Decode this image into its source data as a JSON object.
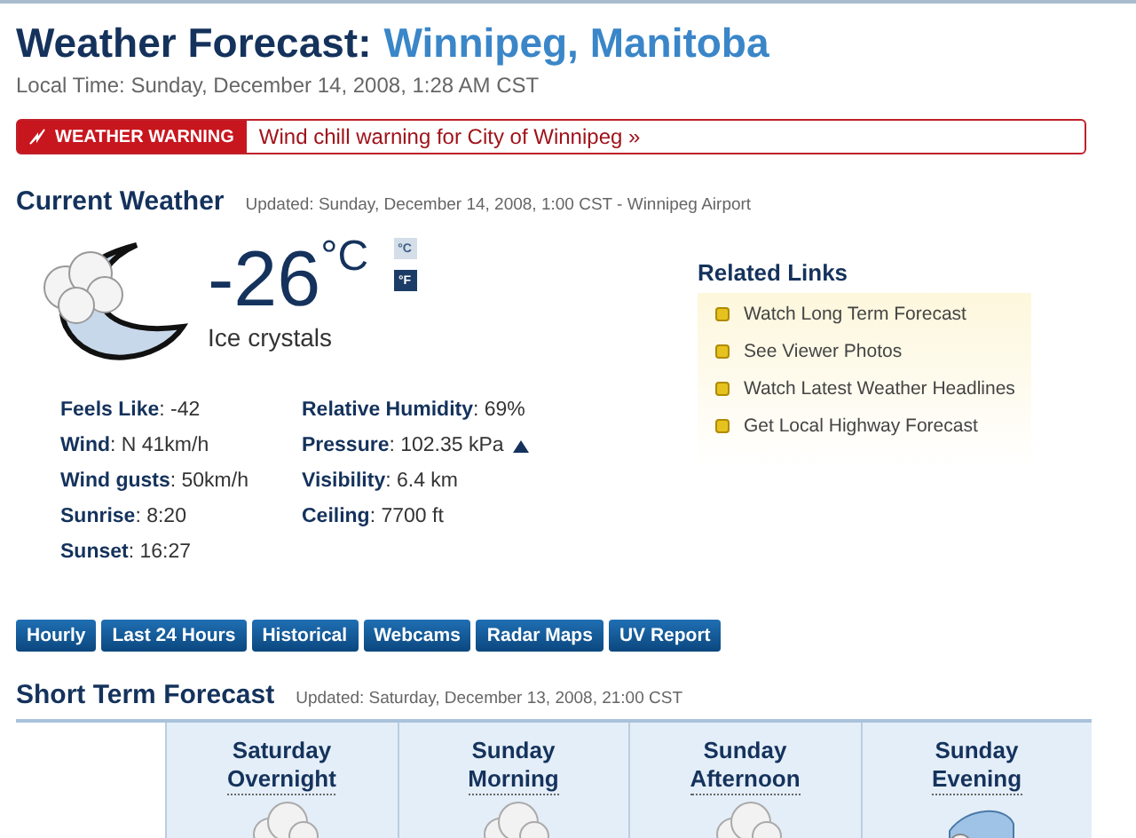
{
  "header": {
    "title": "Weather Forecast:",
    "location": "Winnipeg, Manitoba",
    "local_time": "Local Time: Sunday, December 14, 2008, 1:28 AM CST"
  },
  "warning": {
    "label": "WEATHER WARNING",
    "message": "Wind chill warning for City of Winnipeg »"
  },
  "current": {
    "heading": "Current Weather",
    "updated": "Updated: Sunday, December 14, 2008, 1:00 CST - Winnipeg Airport",
    "temperature": "-26",
    "unit": "°C",
    "condition": "Ice crystals",
    "units": [
      {
        "label": "°C",
        "selected": true
      },
      {
        "label": "°F",
        "selected": false
      }
    ],
    "stats_left": [
      {
        "label": "Feels Like",
        "value": ": -42"
      },
      {
        "label": "Wind",
        "value": ": N 41km/h"
      },
      {
        "label": "Wind gusts",
        "value": ": 50km/h"
      },
      {
        "label": "Sunrise",
        "value": ": 8:20"
      },
      {
        "label": "Sunset",
        "value": ": 16:27"
      }
    ],
    "stats_right": [
      {
        "label": "Relative Humidity",
        "value": ": 69%",
        "kind": "plain"
      },
      {
        "label": "Pressure",
        "value": ": 102.35 kPa",
        "kind": "rising"
      },
      {
        "label": "Visibility",
        "value": ": 6.4 km",
        "kind": "plain"
      },
      {
        "label": "Ceiling",
        "value": ": 7700 ft",
        "kind": "plain"
      }
    ]
  },
  "related_links": {
    "heading": "Related Links",
    "items": [
      "Watch Long Term Forecast",
      "See Viewer Photos",
      "Watch Latest Weather Headlines",
      "Get Local Highway Forecast"
    ]
  },
  "tabs": [
    "Hourly",
    "Last 24 Hours",
    "Historical",
    "Webcams",
    "Radar Maps",
    "UV Report"
  ],
  "short_term": {
    "heading": "Short Term Forecast",
    "updated": "Updated: Saturday, December 13, 2008, 21:00 CST",
    "periods": [
      {
        "day": "Saturday",
        "part": "Overnight",
        "kind": "cloud"
      },
      {
        "day": "Sunday",
        "part": "Morning",
        "kind": "cloud"
      },
      {
        "day": "Sunday",
        "part": "Afternoon",
        "kind": "cloud"
      },
      {
        "day": "Sunday",
        "part": "Evening",
        "kind": "moon"
      }
    ]
  }
}
